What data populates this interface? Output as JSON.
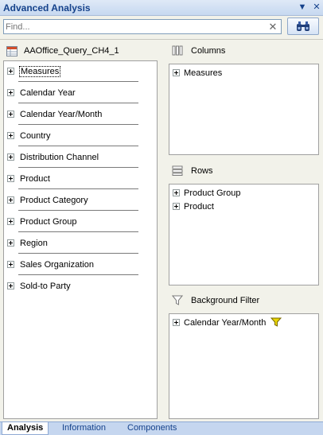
{
  "window": {
    "title": "Advanced Analysis",
    "menu_glyph": "▼",
    "close_glyph": "✕"
  },
  "search": {
    "placeholder": "Find...",
    "clear_glyph": "✕",
    "button_icon": "binoculars-icon"
  },
  "query": {
    "name": "AAOffice_Query_CH4_1"
  },
  "fields": [
    {
      "label": "Measures",
      "selected": true
    },
    {
      "label": "Calendar Year"
    },
    {
      "label": "Calendar Year/Month"
    },
    {
      "label": "Country"
    },
    {
      "label": "Distribution Channel"
    },
    {
      "label": "Product"
    },
    {
      "label": "Product Category"
    },
    {
      "label": "Product Group"
    },
    {
      "label": "Region"
    },
    {
      "label": "Sales Organization"
    },
    {
      "label": "Sold-to Party"
    }
  ],
  "columns": {
    "title": "Columns",
    "items": [
      "Measures"
    ]
  },
  "rows": {
    "title": "Rows",
    "items": [
      "Product Group",
      "Product"
    ]
  },
  "background_filter": {
    "title": "Background Filter",
    "items": [
      "Calendar Year/Month"
    ]
  },
  "tabs": [
    "Analysis",
    "Information",
    "Components"
  ],
  "colors": {
    "title_text": "#15428b",
    "tab_strip": "#c5d6ef",
    "filter_funnel": "#e8d400"
  }
}
